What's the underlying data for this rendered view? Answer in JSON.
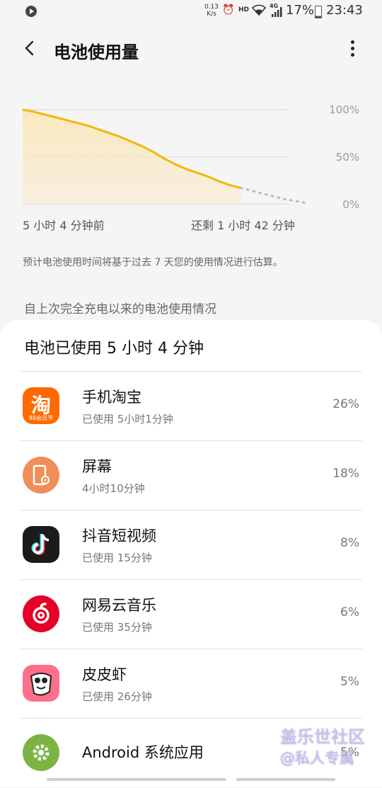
{
  "status_bar": {
    "net_speed": "0.13",
    "net_unit": "K/s",
    "hd": "HD",
    "signal": "4G",
    "battery_percent": "17%",
    "time": "23:43"
  },
  "header": {
    "title": "电池使用量"
  },
  "chart_data": {
    "type": "line",
    "y_tick_labels": [
      "100%",
      "50%",
      "0%"
    ],
    "ylim": [
      0,
      100
    ],
    "x_start_label": "5 小时 4 分钟前",
    "x_end_label": "还剩 1 小时 42 分钟",
    "series": [
      {
        "values": [
          100,
          98,
          95,
          92,
          89,
          86,
          83,
          79,
          75,
          71,
          66,
          61,
          55,
          48,
          42,
          37,
          33,
          29,
          24,
          20,
          17
        ]
      },
      {
        "values": [
          17,
          14,
          11,
          8,
          5,
          3,
          1
        ]
      }
    ],
    "colors": {
      "usage": "#f2b705",
      "fill": "#fbe7b8",
      "projection": "#bcbcbc"
    },
    "grid": true
  },
  "estimate_note": "预计电池使用时间将基于过去 7 天您的使用情况进行估算。",
  "section_label": "自上次完全充电以来的电池使用情况",
  "usage_card": {
    "title": "电池已使用 5 小时 4 分钟",
    "apps": [
      {
        "name": "手机淘宝",
        "detail": "已使用 5小时1分钟",
        "percent": "26%",
        "icon": "taobao-icon",
        "badge": "88会员节",
        "glyph": "淘"
      },
      {
        "name": "屏幕",
        "detail": "4小时10分钟",
        "percent": "18%",
        "icon": "screen-icon"
      },
      {
        "name": "抖音短视频",
        "detail": "已使用 15分钟",
        "percent": "8%",
        "icon": "douyin-icon"
      },
      {
        "name": "网易云音乐",
        "detail": "已使用 35分钟",
        "percent": "6%",
        "icon": "netease-music-icon"
      },
      {
        "name": "皮皮虾",
        "detail": "已使用 26分钟",
        "percent": "5%",
        "icon": "pipixia-icon"
      },
      {
        "name": "Android 系统应用",
        "detail": "",
        "percent": "5%",
        "icon": "android-system-icon"
      }
    ]
  },
  "watermark": {
    "line1": "盖乐世社区",
    "line2": "@私人专属"
  }
}
